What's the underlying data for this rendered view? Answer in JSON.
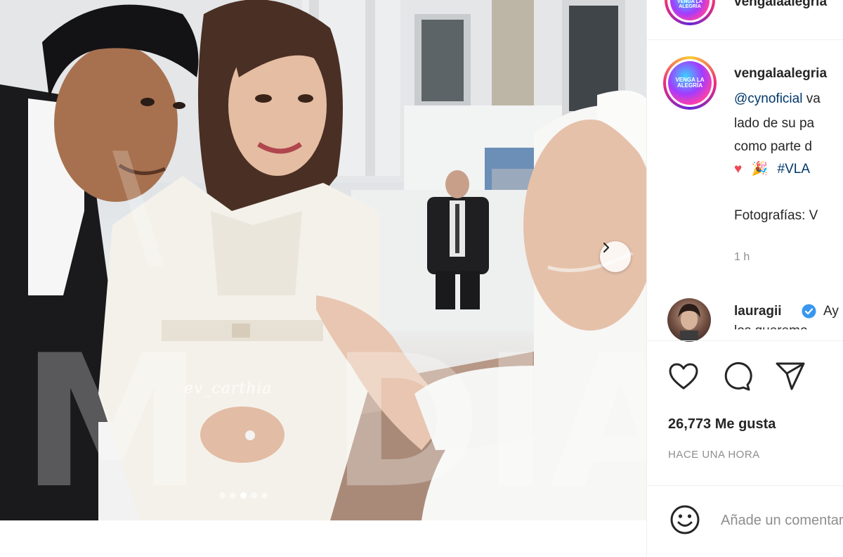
{
  "account": {
    "username": "vengalaalegria",
    "avatar_icon": "vla-logo-icon",
    "avatar_label": "VENGA LA ALEGRÍA"
  },
  "caption": {
    "username": "vengalaalegria",
    "mention": "@cynoficial",
    "line1_rest": " va",
    "line2": "lado de su pa",
    "line3": "como parte d",
    "emoji_heart": "♥",
    "emoji_party": "🎉",
    "hashtag": "#VLA",
    "photo_credit": "Fotografías: V",
    "timestamp": "1 h"
  },
  "comment": {
    "username": "lauragii",
    "verified_icon": "verified-badge-icon",
    "text": "Ay",
    "text_line2": "los queremo"
  },
  "actions": {
    "like_icon": "heart-icon",
    "comment_icon": "comment-icon",
    "share_icon": "share-icon"
  },
  "likes_label": "26,773 Me gusta",
  "time_label": "HACE UNA HORA",
  "add_comment": {
    "emoji_icon": "emoji-icon",
    "placeholder": "Añade un comentario..."
  },
  "media": {
    "watermark_signature": "ev_carthia",
    "carousel": {
      "current": 3,
      "total": 5
    },
    "next_icon": "chevron-right-icon"
  },
  "colors": {
    "text": "#262626",
    "secondary": "#8e8e8e",
    "link": "#00376b",
    "heart": "#ed4956"
  }
}
